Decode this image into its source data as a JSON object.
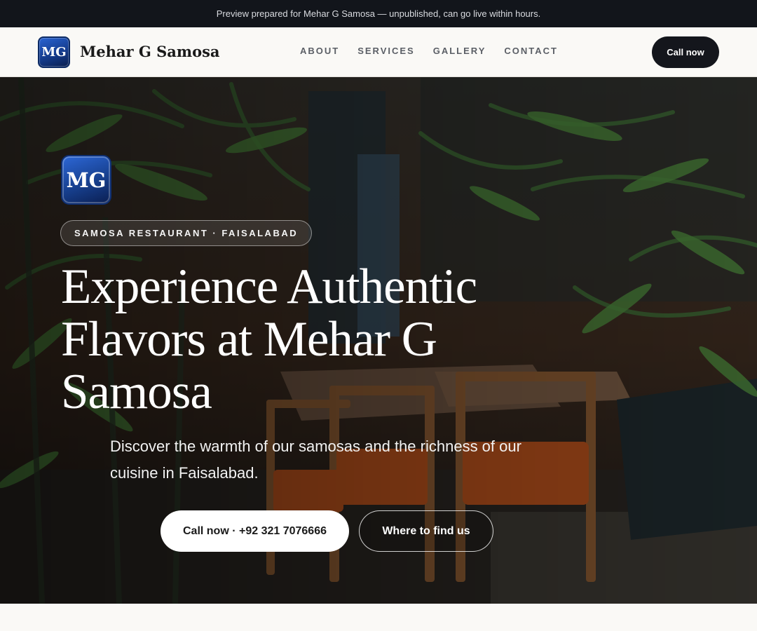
{
  "announcement": "Preview prepared for Mehar G Samosa — unpublished, can go live within hours.",
  "brand": {
    "logo_text": "MG",
    "name": "Mehar G Samosa"
  },
  "nav": {
    "links": [
      "ABOUT",
      "SERVICES",
      "GALLERY",
      "CONTACT"
    ],
    "cta": "Call now"
  },
  "hero": {
    "logo_text": "MG",
    "tag": "SAMOSA RESTAURANT · FAISALABAD",
    "title": "Experience Authentic Flavors at Mehar G Samosa",
    "subtitle": "Discover the warmth of our samosas and the richness of our cuisine in Faisalabad.",
    "primary_button": "Call now · +92 321 7076666",
    "secondary_button": "Where to find us"
  },
  "colors": {
    "dark": "#12151b",
    "accent_blue": "#1e4fb0",
    "page_bg": "#faf9f6"
  }
}
